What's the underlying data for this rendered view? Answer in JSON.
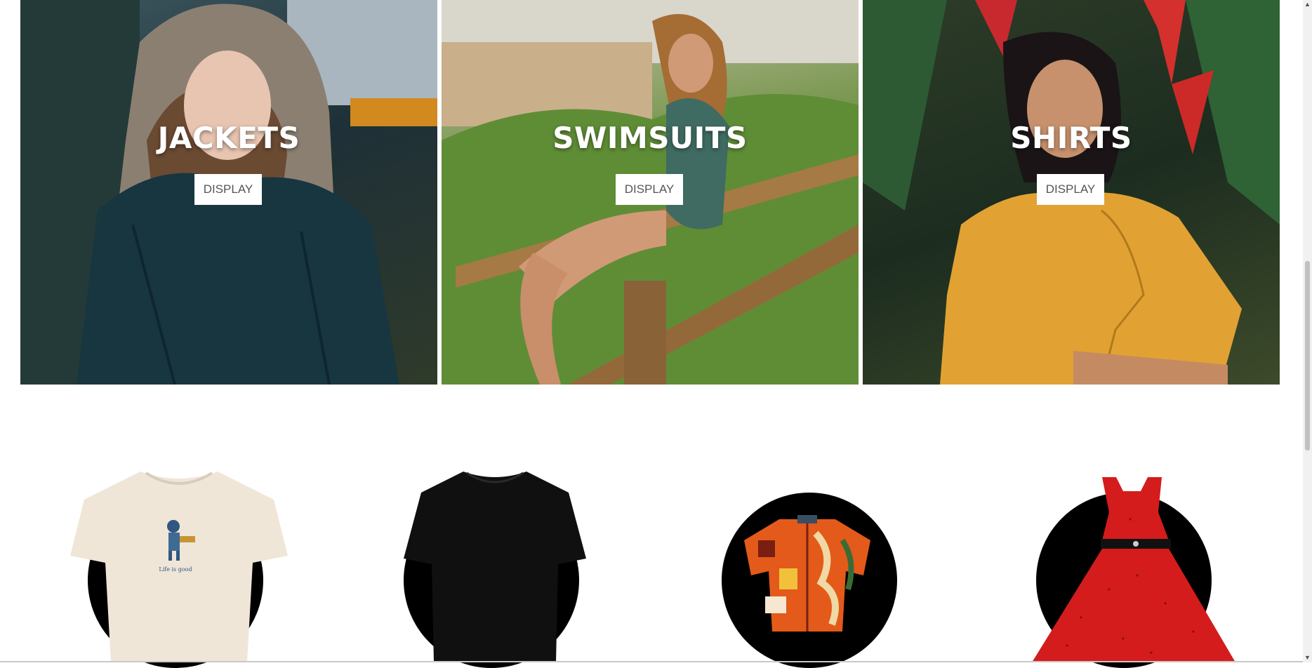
{
  "categories": [
    {
      "title": "JACKETS",
      "button_label": "DISPLAY"
    },
    {
      "title": "SWIMSUITS",
      "button_label": "DISPLAY"
    },
    {
      "title": "SHIRTS",
      "button_label": "DISPLAY"
    }
  ],
  "products": [
    {
      "item": "cream-tshirt"
    },
    {
      "item": "black-tshirt"
    },
    {
      "item": "printed-shirt"
    },
    {
      "item": "red-dress"
    }
  ],
  "icons": {
    "scroll_up": "chevron-up-icon",
    "scroll_down": "chevron-down-icon"
  }
}
